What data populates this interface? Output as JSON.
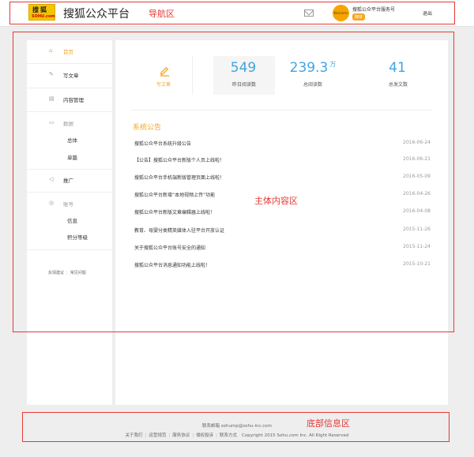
{
  "header": {
    "logo_line1": "搜狐",
    "logo_line2": "SOHU.com",
    "app_title": "搜狐公众平台",
    "account_name": "搜狐公众平台服务号",
    "account_badge": "媒体",
    "avatar_text": "Welcome",
    "logout_label": "退出"
  },
  "sidebar": {
    "items": [
      {
        "label": "首页",
        "icon": "home-icon"
      },
      {
        "label": "写文章",
        "icon": "pencil-icon"
      },
      {
        "label": "内容管理",
        "icon": "folder-icon"
      },
      {
        "label": "数据",
        "icon": "chart-icon"
      },
      {
        "label": "推广",
        "icon": "megaphone-icon"
      },
      {
        "label": "账号",
        "icon": "user-icon"
      }
    ],
    "data_sub": [
      "总体",
      "单篇"
    ],
    "account_sub": [
      "信息",
      "积分等级"
    ],
    "footer_links": [
      "反馈建议",
      "常见问题"
    ]
  },
  "main": {
    "write_label": "写文章",
    "stats": [
      {
        "value": "549",
        "unit": "",
        "label": "昨日阅读数"
      },
      {
        "value": "239.3",
        "unit": "万",
        "label": "总阅读数"
      },
      {
        "value": "41",
        "unit": "",
        "label": "总发文数"
      }
    ],
    "announcements_title": "系统公告",
    "announcements": [
      {
        "title": "搜狐公众平台系统升级公告",
        "date": "2016-06-24"
      },
      {
        "title": "【公告】搜狐公众平台新版个人页上线啦！",
        "date": "2016-06-21"
      },
      {
        "title": "搜狐公众平台手机端新版管理页面上线啦！",
        "date": "2016-05-09"
      },
      {
        "title": "搜狐公众平台新增“本地视频上传”功能",
        "date": "2016-04-26"
      },
      {
        "title": "搜狐公众平台新版文章编辑器上线啦！",
        "date": "2016-04-08"
      },
      {
        "title": "教育、母婴分类精英媒体入驻平台开放认证",
        "date": "2015-11-26"
      },
      {
        "title": "关于搜狐公众平台账号安全的通知",
        "date": "2015-11-24"
      },
      {
        "title": "搜狐公众平台消息通知功能上线啦！",
        "date": "2015-10-21"
      }
    ]
  },
  "footer": {
    "contact": "联系邮箱 sohump@sohu-inc.com",
    "links": [
      "关于我们",
      "运营规范",
      "服务协议",
      "侵权投诉",
      "联系方式"
    ],
    "copyright": "Copyright 2015 Sohu.com Inc. All Right Reserved"
  },
  "annotations": {
    "nav_area": "导航区",
    "main_area": "主体内容区",
    "footer_area": "底部信息区"
  },
  "colors": {
    "accent": "#f5a623",
    "stat_blue": "#3fa4e0",
    "annotation_red": "#e53935"
  }
}
